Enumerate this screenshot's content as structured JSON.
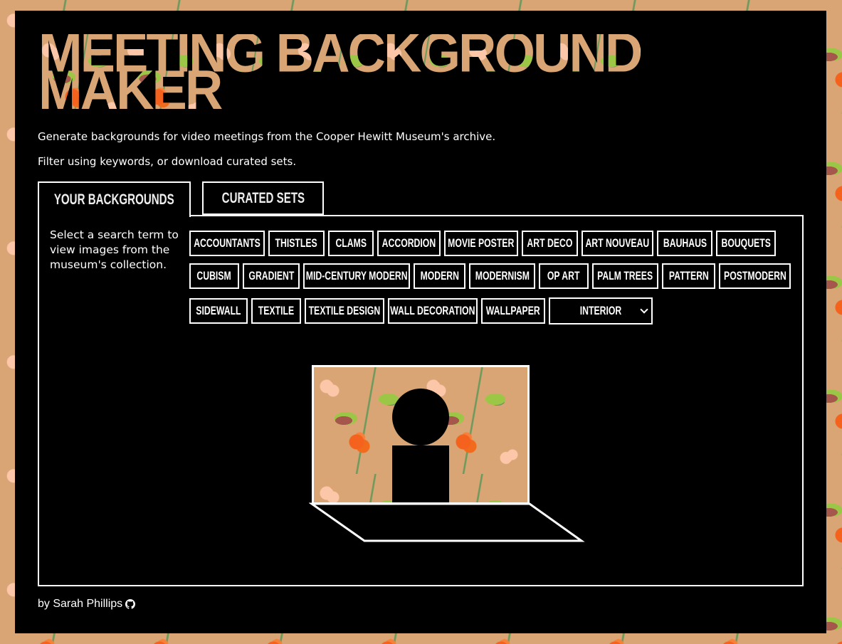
{
  "app": {
    "title_line1": "Meeting Background",
    "title_line2": "Maker"
  },
  "intro": {
    "line1": "Generate backgrounds for video meetings from the Cooper Hewitt Museum's archive.",
    "line2": "Filter using keywords, or download curated sets."
  },
  "tabs": [
    {
      "label": "Your Backgrounds",
      "active": true
    },
    {
      "label": "Curated Sets",
      "active": false
    }
  ],
  "panel": {
    "hint": "Select a search term to view images from the museum's collection.",
    "tag_rows": [
      [
        "Accountants",
        "Thistles",
        "Clams",
        "Accordion",
        "Movie Poster",
        "Art Deco",
        "Art Nouveau",
        "Bauhaus",
        "Bouquets"
      ],
      [
        "Cubism",
        "Gradient",
        "Mid-Century Modern",
        "Modern",
        "Modernism",
        "Op Art",
        "Palm Trees",
        "Pattern",
        "Postmodern"
      ],
      [
        "Sidewall",
        "Textile",
        "Textile Design",
        "Wall Decoration",
        "Wallpaper"
      ]
    ],
    "select": {
      "selected": "Interior",
      "icon": "chevron-down-icon"
    },
    "preview": {
      "description": "Laptop preview showing a person silhouette over the selected floral wallpaper background"
    }
  },
  "footer": {
    "credit": "by Sarah Phillips",
    "icon": "github-icon"
  },
  "colors": {
    "panel_bg": "#000000",
    "border": "#ffffff",
    "floral_tan": "#d9a574",
    "floral_peach": "#fcc6a8",
    "floral_orange": "#f4621e",
    "floral_green": "#9cc645",
    "floral_sage": "#6f9a5e",
    "floral_brown": "#a4574a"
  }
}
